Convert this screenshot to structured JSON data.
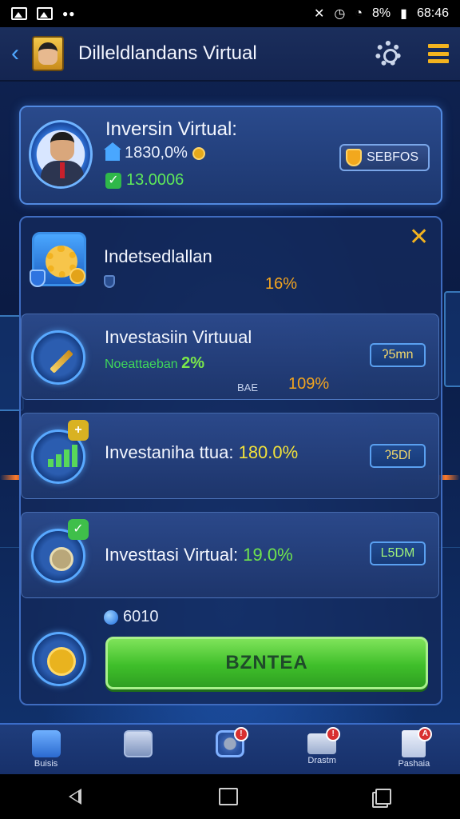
{
  "status_bar": {
    "right_text": "8%",
    "time": "68:46",
    "wifi_icon": "wifi-icon",
    "battery_icon": "battery-icon"
  },
  "header": {
    "title": "Dilleldlandans Virtual",
    "back_icon": "chevron-left-icon",
    "settings_icon": "gear-icon",
    "menu_icon": "menu-icon"
  },
  "profile": {
    "name": "Inversin Virtual:",
    "stat_primary": "1830,0%",
    "stat_secondary": "13.0006",
    "badge": "SEBFOS"
  },
  "investments": [
    {
      "title": "Indetsedlallan",
      "percent": "16%"
    },
    {
      "title": "Investasiin Virtuual",
      "subtitle": "Noeattaeban",
      "subtitle_value": "2%",
      "label": "BAE",
      "percent": "109%",
      "pill": "ʔ5mn"
    },
    {
      "title": "Investaniha ttua:",
      "percent": "180.0%",
      "pill": "ʔ5Dſ",
      "tag": "+"
    },
    {
      "title": "Investtasi Virtual:",
      "percent": "19.0%",
      "pill": "L5DM",
      "tag": "✓"
    }
  ],
  "balance": {
    "value": "6010"
  },
  "action_button": {
    "label": "BZNTEA"
  },
  "bottom_nav": [
    {
      "label": "Buisis",
      "icon": "person-icon",
      "badge": ""
    },
    {
      "label": "",
      "icon": "photo-icon",
      "badge": ""
    },
    {
      "label": "",
      "icon": "target-icon",
      "badge": "!"
    },
    {
      "label": "Drastm",
      "icon": "mail-icon",
      "badge": "!"
    },
    {
      "label": "Pashaia",
      "icon": "clipboard-icon",
      "badge": "A"
    }
  ],
  "colors": {
    "accent_blue": "#4fa8ff",
    "gold": "#f2b21f",
    "green": "#3fbf2a",
    "percent_orange": "#f2a41f"
  }
}
